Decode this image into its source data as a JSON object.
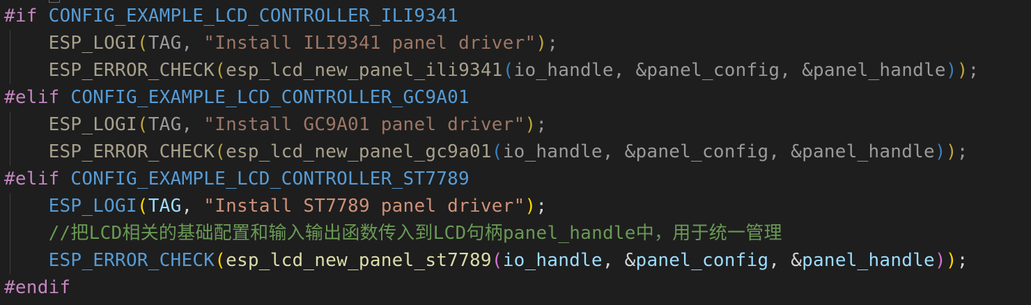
{
  "lines": [
    [
      {
        "t": "#if ",
        "c": "c-directive"
      },
      {
        "t": "CONFIG_EXAMPLE_LCD_CONTROLLER_ILI9341",
        "c": "c-macro-active"
      }
    ],
    [
      {
        "t": "    ",
        "c": ""
      },
      {
        "t": "ESP_LOGI",
        "c": "c-fn-inactive"
      },
      {
        "t": "(",
        "c": "c-paren1-dim"
      },
      {
        "t": "TAG, ",
        "c": "c-ident-inactive"
      },
      {
        "t": "\"Install ILI9341 panel driver\"",
        "c": "c-str-inactive"
      },
      {
        "t": ")",
        "c": "c-paren1-dim"
      },
      {
        "t": ";",
        "c": "c-punc-inactive"
      }
    ],
    [
      {
        "t": "    ",
        "c": ""
      },
      {
        "t": "ESP_ERROR_CHECK",
        "c": "c-fn-inactive"
      },
      {
        "t": "(",
        "c": "c-paren1-dim"
      },
      {
        "t": "esp_lcd_new_panel_ili9341",
        "c": "c-fn-inactive"
      },
      {
        "t": "(",
        "c": "c-paren3-dim"
      },
      {
        "t": "io_handle, &panel_config, &panel_handle",
        "c": "c-ident-inactive"
      },
      {
        "t": ")",
        "c": "c-paren3-dim"
      },
      {
        "t": ")",
        "c": "c-paren1-dim"
      },
      {
        "t": ";",
        "c": "c-punc-inactive"
      }
    ],
    [
      {
        "t": "#elif ",
        "c": "c-directive"
      },
      {
        "t": "CONFIG_EXAMPLE_LCD_CONTROLLER_GC9A01",
        "c": "c-macro-active"
      }
    ],
    [
      {
        "t": "    ",
        "c": ""
      },
      {
        "t": "ESP_LOGI",
        "c": "c-fn-inactive"
      },
      {
        "t": "(",
        "c": "c-paren1-dim"
      },
      {
        "t": "TAG, ",
        "c": "c-ident-inactive"
      },
      {
        "t": "\"Install GC9A01 panel driver\"",
        "c": "c-str-inactive"
      },
      {
        "t": ")",
        "c": "c-paren1-dim"
      },
      {
        "t": ";",
        "c": "c-punc-inactive"
      }
    ],
    [
      {
        "t": "    ",
        "c": ""
      },
      {
        "t": "ESP_ERROR_CHECK",
        "c": "c-fn-inactive"
      },
      {
        "t": "(",
        "c": "c-paren1-dim"
      },
      {
        "t": "esp_lcd_new_panel_gc9a01",
        "c": "c-fn-inactive"
      },
      {
        "t": "(",
        "c": "c-paren3-dim"
      },
      {
        "t": "io_handle, &panel_config, &panel_handle",
        "c": "c-ident-inactive"
      },
      {
        "t": ")",
        "c": "c-paren3-dim"
      },
      {
        "t": ")",
        "c": "c-paren1-dim"
      },
      {
        "t": ";",
        "c": "c-punc-inactive"
      }
    ],
    [
      {
        "t": "#elif ",
        "c": "c-directive"
      },
      {
        "t": "CONFIG_EXAMPLE_LCD_CONTROLLER_ST7789",
        "c": "c-macro-active"
      }
    ],
    [
      {
        "t": "    ",
        "c": ""
      },
      {
        "t": "ESP_LOGI",
        "c": "c-macro"
      },
      {
        "t": "(",
        "c": "c-paren1"
      },
      {
        "t": "TAG",
        "c": "c-ident"
      },
      {
        "t": ", ",
        "c": "c-punc"
      },
      {
        "t": "\"Install ST7789 panel driver\"",
        "c": "c-str"
      },
      {
        "t": ")",
        "c": "c-paren1"
      },
      {
        "t": ";",
        "c": "c-punc"
      }
    ],
    [
      {
        "t": "    ",
        "c": ""
      },
      {
        "t": "//把LCD相关的基础配置和输入输出函数传入到LCD句柄panel_handle中，用于统一管理",
        "c": "c-comment"
      }
    ],
    [
      {
        "t": "    ",
        "c": ""
      },
      {
        "t": "ESP_ERROR_CHECK",
        "c": "c-macro"
      },
      {
        "t": "(",
        "c": "c-paren1"
      },
      {
        "t": "esp_lcd_new_panel_st7789",
        "c": "c-fn"
      },
      {
        "t": "(",
        "c": "c-paren2"
      },
      {
        "t": "io_handle",
        "c": "c-ident"
      },
      {
        "t": ", &",
        "c": "c-punc"
      },
      {
        "t": "panel_config",
        "c": "c-ident"
      },
      {
        "t": ", &",
        "c": "c-punc"
      },
      {
        "t": "panel_handle",
        "c": "c-ident"
      },
      {
        "t": ")",
        "c": "c-paren2"
      },
      {
        "t": ")",
        "c": "c-paren1"
      },
      {
        "t": ";",
        "c": "c-punc"
      }
    ],
    [
      {
        "t": "#endif",
        "c": "c-directive"
      }
    ]
  ]
}
